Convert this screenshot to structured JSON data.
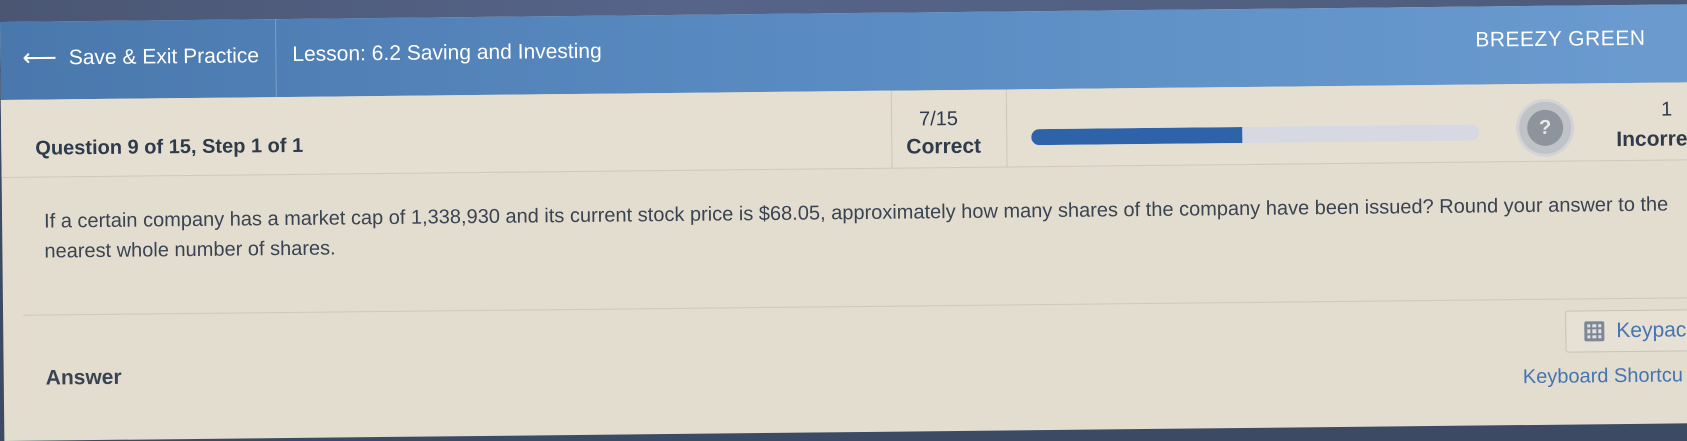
{
  "header": {
    "back_label": "Save & Exit Practice",
    "lesson_title": "Lesson: 6.2 Saving and Investing",
    "user_name": "BREEZY GREEN"
  },
  "status": {
    "question_label": "Question 9 of 15, Step 1 of 1",
    "correct_count": "7/15",
    "correct_label": "Correct",
    "progress_fraction": 0.47,
    "incorrect_count": "1",
    "incorrect_label": "Incorre"
  },
  "question": {
    "text": "If a certain company has a market cap of 1,338,930 and its current stock price is $68.05, approximately how many shares of the company have been issued? Round your answer to the nearest whole number of shares."
  },
  "answer": {
    "label": "Answer",
    "keypad_label": "Keypac",
    "shortcuts_label": "Keyboard Shortcu"
  },
  "colors": {
    "header_blue": "#5a8cc3",
    "progress_fill": "#2f63a9",
    "link_blue": "#4574b0"
  },
  "icons": [
    "left-arrow-icon",
    "help-icon",
    "calculator-icon"
  ]
}
